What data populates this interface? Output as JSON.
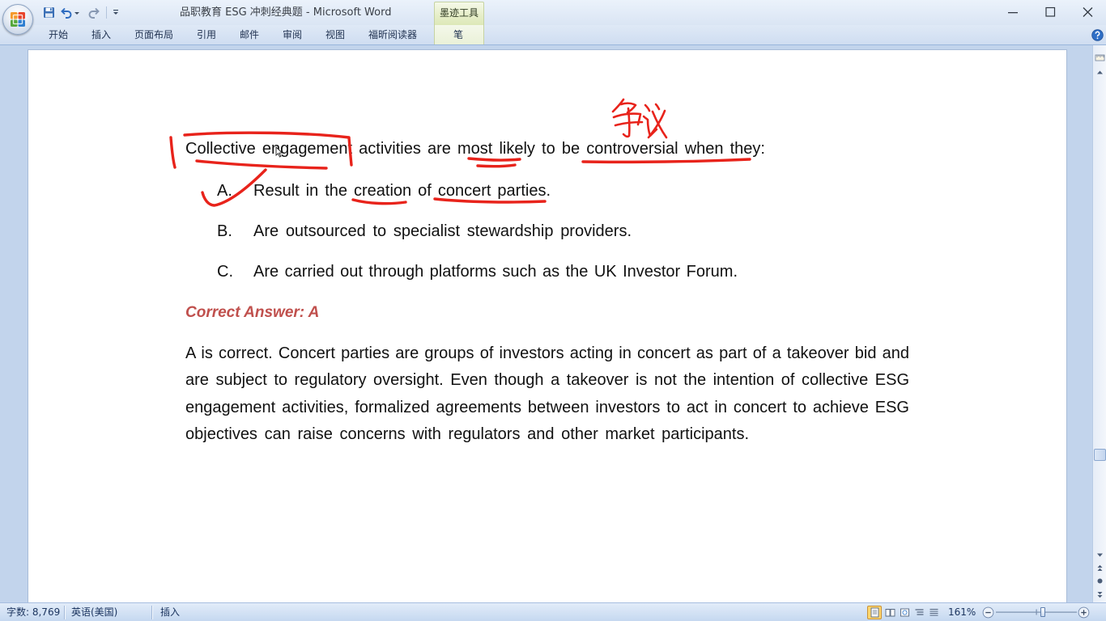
{
  "window": {
    "title": "品职教育 ESG 冲刺经典题 - Microsoft Word",
    "contextual_group": "墨迹工具",
    "icons": [
      "minimize-icon",
      "maximize-icon",
      "close-icon"
    ]
  },
  "quick_access_toolbar": {
    "icons": [
      "office-logo-icon",
      "save-icon",
      "undo-icon",
      "dropdown-arrow-icon",
      "redo-icon",
      "customize-toolbar-icon"
    ]
  },
  "ribbon": {
    "tabs": [
      "开始",
      "插入",
      "页面布局",
      "引用",
      "邮件",
      "审阅",
      "视图",
      "福昕阅读器",
      "笔"
    ],
    "help_icon": "help-icon"
  },
  "document": {
    "question": "Collective engagement activities are most likely to be controversial when they:",
    "options": [
      {
        "letter": "A.",
        "text": "Result in the creation of concert parties."
      },
      {
        "letter": "B.",
        "text": "Are outsourced to specialist stewardship providers."
      },
      {
        "letter": "C.",
        "text": "Are carried out through platforms such as the UK Investor Forum."
      }
    ],
    "answer": "Correct Answer: A",
    "explanation_lines": [
      "A is correct. Concert parties are groups of investors acting in concert as part of a takeover bid and",
      "are subject to regulatory oversight. Even though a takeover is not the intention of collective ESG",
      "engagement activities, formalized agreements between investors to act in concert to achieve ESG",
      "objectives can raise concerns with regulators and other market participants."
    ]
  },
  "scrollbar": {
    "position_fraction": 0.81,
    "icons": [
      "view-ruler-icon",
      "scroll-up-icon",
      "scroll-down-icon",
      "previous-page-icon",
      "select-browse-object-icon",
      "next-page-icon"
    ]
  },
  "status_bar": {
    "word_count": "字数: 8,769",
    "language": "英语(美国)",
    "mode": "插入",
    "zoom_label": "161%",
    "zoom_percent": 161,
    "view_icons": [
      "print-layout-icon",
      "full-screen-reading-icon",
      "web-layout-icon",
      "outline-icon",
      "draft-icon"
    ],
    "active_view": "print-layout-icon"
  },
  "colors": {
    "answer_text": "#c0504d",
    "ink": "#e8231b",
    "active_view_bg": "#ffd66e",
    "workspace_bg": "#c2d4ec"
  }
}
